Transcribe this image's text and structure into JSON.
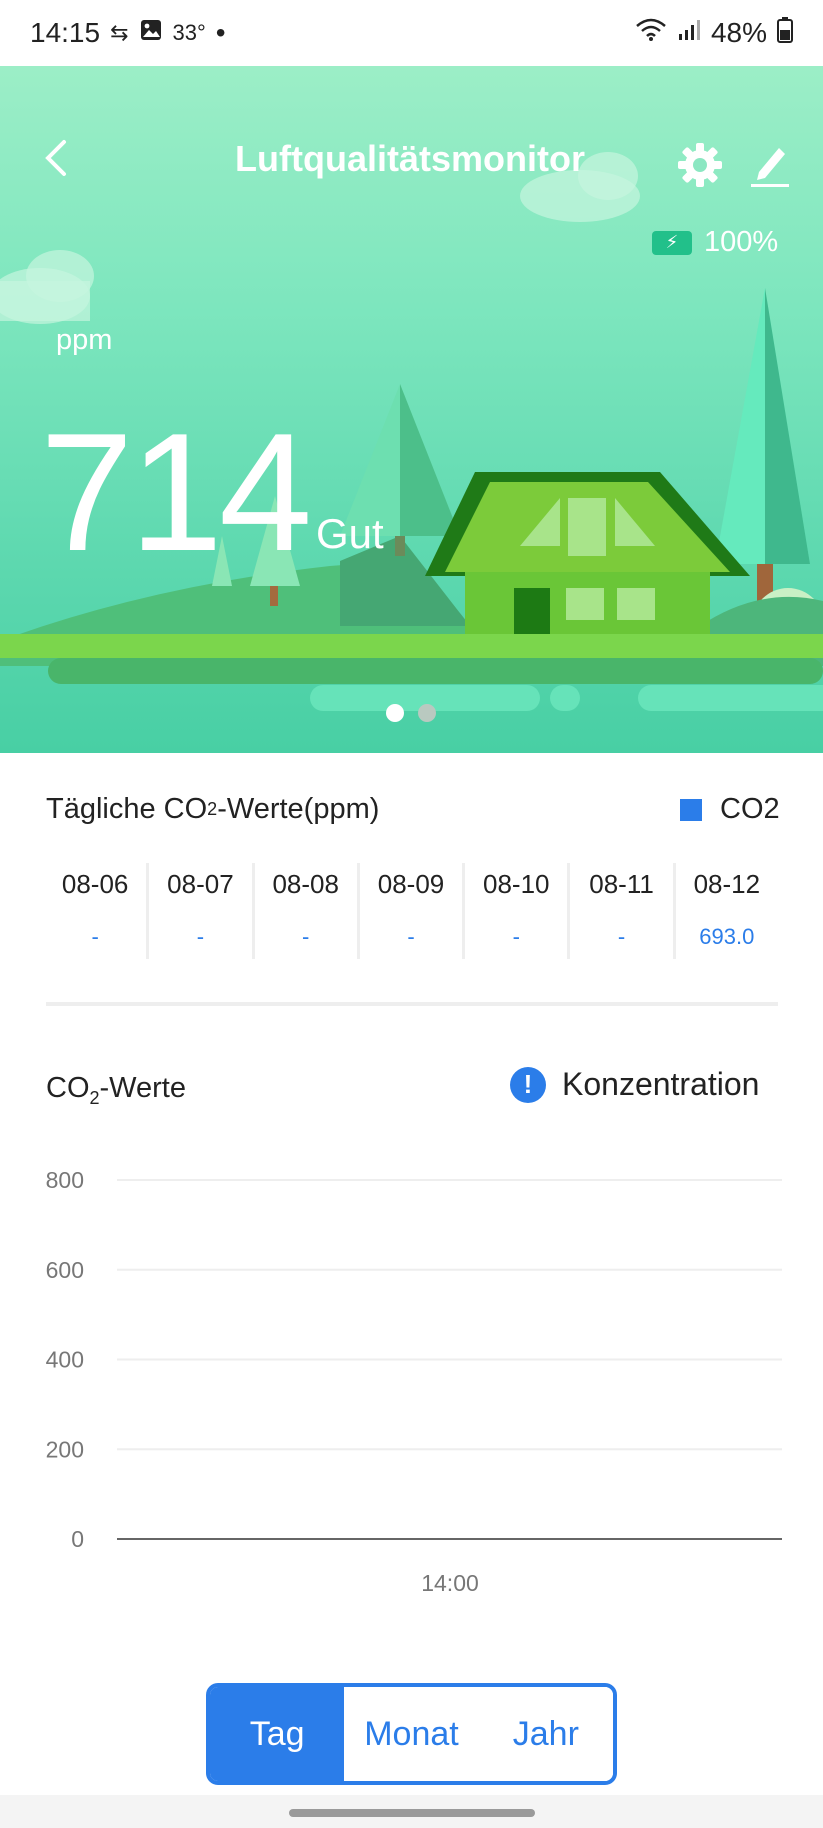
{
  "status_bar": {
    "time": "14:15",
    "temperature": "33°",
    "battery": "48%",
    "icons": [
      "data-transfer-icon",
      "image-icon",
      "dot-icon",
      "wifi-icon",
      "signal-icon",
      "battery-icon"
    ]
  },
  "header": {
    "title": "Luftqualitätsmonitor",
    "battery_level": "100%",
    "icons": [
      "back-arrow-icon",
      "gear-icon",
      "edit-pencil-icon",
      "battery-charging-icon"
    ]
  },
  "reading": {
    "unit": "ppm",
    "value": "714",
    "quality": "Gut",
    "page_dots": 2,
    "active_page": 1
  },
  "daily": {
    "title_prefix": "Tägliche CO",
    "title_sub": "2",
    "title_suffix": "-Werte(ppm)",
    "legend": "CO2",
    "days": [
      {
        "date": "08-06",
        "value": "-"
      },
      {
        "date": "08-07",
        "value": "-"
      },
      {
        "date": "08-08",
        "value": "-"
      },
      {
        "date": "08-09",
        "value": "-"
      },
      {
        "date": "08-10",
        "value": "-"
      },
      {
        "date": "08-11",
        "value": "-"
      },
      {
        "date": "08-12",
        "value": "693.0"
      }
    ]
  },
  "chart_section": {
    "title_prefix": "CO",
    "title_sub": "2",
    "title_suffix": "-Werte",
    "info_label": "Konzentration",
    "info_glyph": "!"
  },
  "chart_data": {
    "type": "line",
    "title": "",
    "xlabel": "",
    "ylabel": "",
    "ylim": [
      0,
      800
    ],
    "y_ticks": [
      0,
      200,
      400,
      600,
      800
    ],
    "x_ticks": [
      "14:00"
    ],
    "grid": true,
    "series": []
  },
  "range_tabs": {
    "tabs": [
      "Tag",
      "Monat",
      "Jahr"
    ],
    "active": "Tag"
  },
  "colors": {
    "accent": "#2b7de9",
    "hero_top": "#9ceec7",
    "hero_bottom": "#48cfa4"
  }
}
